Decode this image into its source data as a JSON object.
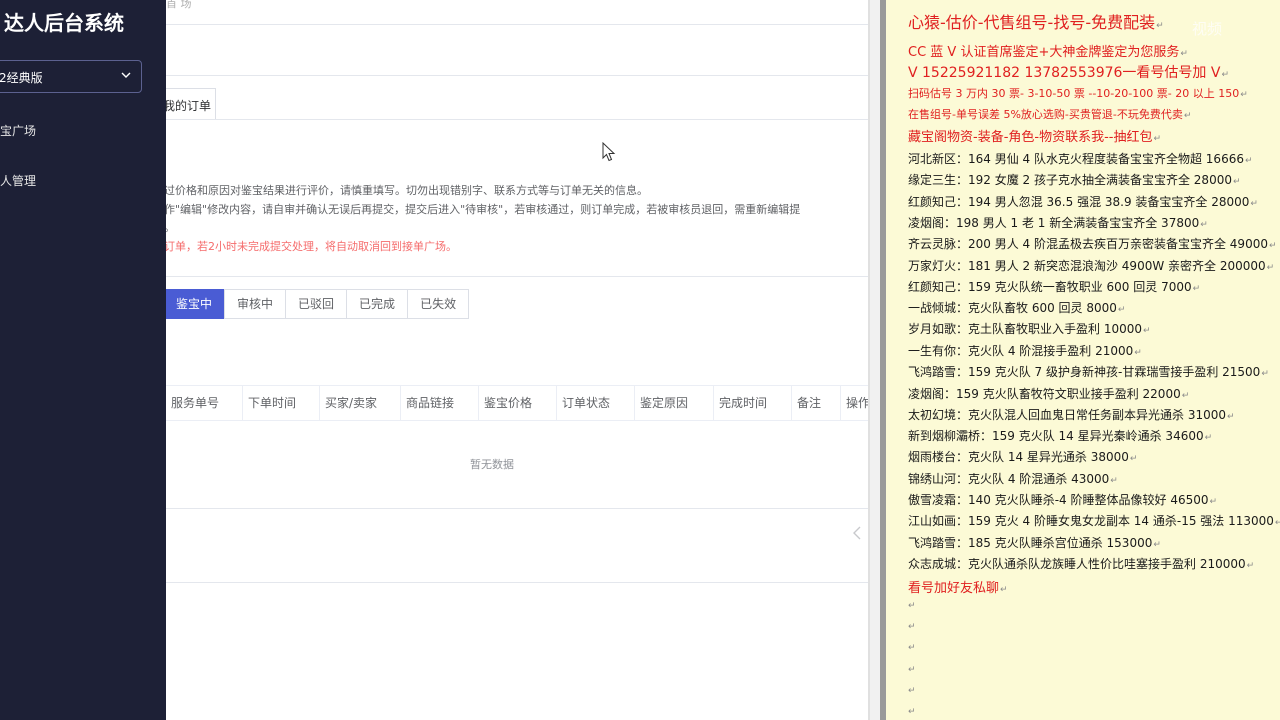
{
  "sidebar": {
    "title": "达人后台系统",
    "select_value": "2经典版",
    "items": [
      {
        "label": "宝广场"
      },
      {
        "label": "人管理"
      }
    ]
  },
  "main": {
    "breadcrumb": "首 场",
    "active_tab": "我的订单",
    "notices": [
      "过价格和原因对鉴宝结果进行评价，请慎重填写。切勿出现错别字、联系方式等与订单无关的信息。",
      "作\"编辑\"修改内容，请自审并确认无误后再提交，提交后进入\"待审核\"，若审核通过，则订单完成，若被审核员退回，需重新编辑提",
      "。",
      "订单，若2小时未完成提交处理，将自动取消回到接单广场。"
    ],
    "status_tabs": [
      "鉴宝中",
      "审核中",
      "已驳回",
      "已完成",
      "已失效"
    ],
    "active_status": "鉴宝中",
    "columns": [
      "服务单号",
      "下单时间",
      "买家/卖家",
      "商品链接",
      "鉴宝价格",
      "订单状态",
      "鉴定原因",
      "完成时间",
      "备注",
      "操作"
    ],
    "empty_text": "暂无数据"
  },
  "notepad": {
    "lines": [
      "心猿-估价-代售组号-找号-免费配装",
      "CC 蓝 V 认证首席鉴定+大神金牌鉴定为您服务",
      "V 15225921182     13782553976一看号估号加 V",
      "扫码估号 3 万内 30 票- 3-10-50 票  --10-20-100 票- 20 以上 150",
      "在售组号-单号误差 5%放心选购-买贵管退-不玩免费代卖",
      "藏宝阁物资-装备-角色-物资联系我--抽红包",
      "河北新区：164 男仙 4 队水克火程度装备宝宝齐全物超 16666",
      "缘定三生：192 女魔 2 孩子克水抽全满装备宝宝齐全 28000",
      "红颜知己：194 男人忽混 36.5 强混 38.9 装备宝宝齐全 28000",
      "凌烟阁：198 男人 1 老 1 新全满装备宝宝齐全 37800",
      "齐云灵脉：200 男人 4 阶混孟极去疾百万亲密装备宝宝齐全 49000",
      "万家灯火：181 男人 2 新突恋混浪淘沙 4900W 亲密齐全 200000",
      "红颜知己：159 克火队统一畜牧职业 600 回灵 7000",
      "一战倾城：克火队畜牧 600 回灵 8000",
      "岁月如歌：克土队畜牧职业入手盈利 10000",
      "一生有你：克火队 4 阶混接手盈利 21000",
      "飞鸿踏雪：159 克火队 7 级护身新神孩-甘霖瑞雪接手盈利 21500",
      "凌烟阁：159 克火队畜牧符文职业接手盈利 22000",
      "太初幻境：克火队混人回血鬼日常任务副本异光通杀 31000",
      "新到烟柳灞桥：159 克火队 14 星异光秦岭通杀 34600",
      "烟雨楼台：克火队 14 星异光通杀 38000",
      "锦绣山河：克火队 4 阶混通杀 43000",
      "傲雪凌霜：140 克火队睡杀-4 阶睡整体品像较好 46500",
      "江山如画：159 克火 4 阶睡女鬼女龙副本 14 通杀-15 强法 113000",
      "飞鸿踏雪：185 克火队睡杀宫位通杀 153000",
      "众志成城：克火队通杀队龙族睡人性价比哇塞接手盈利 210000",
      "看号加好友私聊"
    ],
    "pilcrow": "↵"
  },
  "watermark": "视频"
}
